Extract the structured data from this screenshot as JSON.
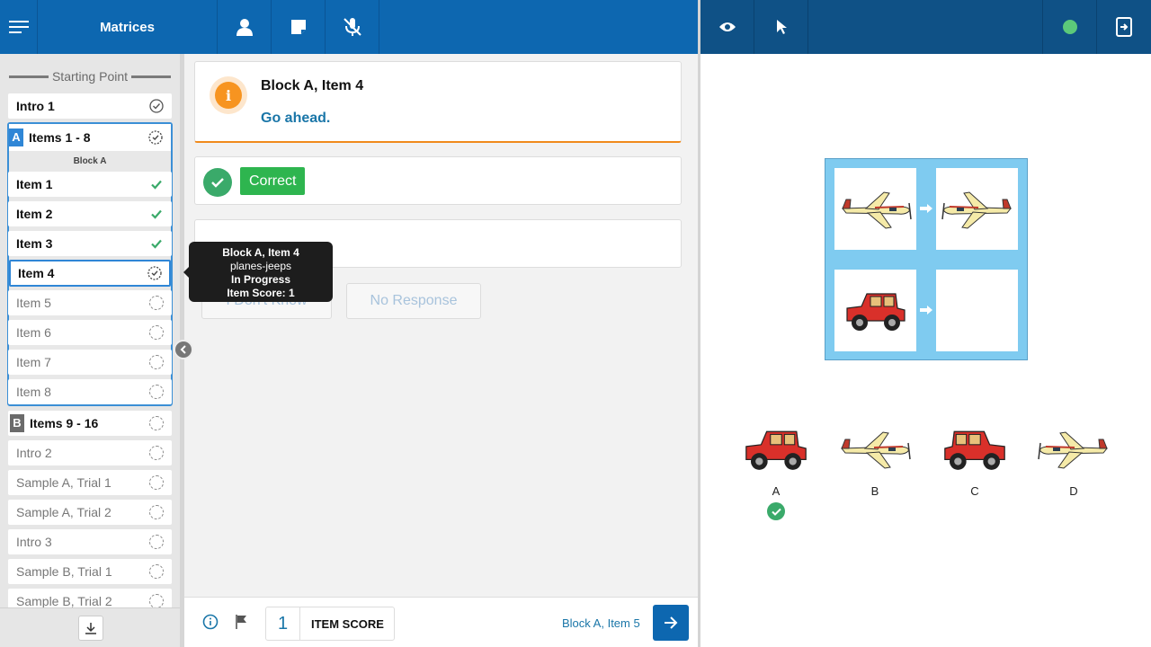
{
  "header": {
    "title": "Matrices"
  },
  "status_color": "#5cc97a",
  "sidebar": {
    "heading": "Starting Point",
    "intro": "Intro 1",
    "block_a": {
      "badge": "A",
      "label": "Items 1 - 8",
      "sublabel": "Block A"
    },
    "items_a": [
      "Item 1",
      "Item 2",
      "Item 3",
      "Item 4",
      "Item 5",
      "Item 6",
      "Item 7",
      "Item 8"
    ],
    "block_b": {
      "badge": "B",
      "label": "Items 9 - 16"
    },
    "items_b": [
      "Intro 2",
      "Sample A, Trial 1",
      "Sample A, Trial 2",
      "Intro 3",
      "Sample B, Trial 1",
      "Sample B, Trial 2"
    ]
  },
  "info": {
    "title": "Block A, Item 4",
    "message": "Go ahead."
  },
  "result": {
    "label": "Correct"
  },
  "response_buttons": {
    "dont_know": "I Don't Know",
    "no_response": "No Response"
  },
  "tooltip": {
    "title": "Block A, Item 4",
    "name": "planes-jeeps",
    "status": "In Progress",
    "score": "Item Score: 1"
  },
  "footer": {
    "score": "1",
    "score_label": "ITEM SCORE",
    "next_label": "Block A, Item 5"
  },
  "choices": [
    "A",
    "B",
    "C",
    "D"
  ]
}
